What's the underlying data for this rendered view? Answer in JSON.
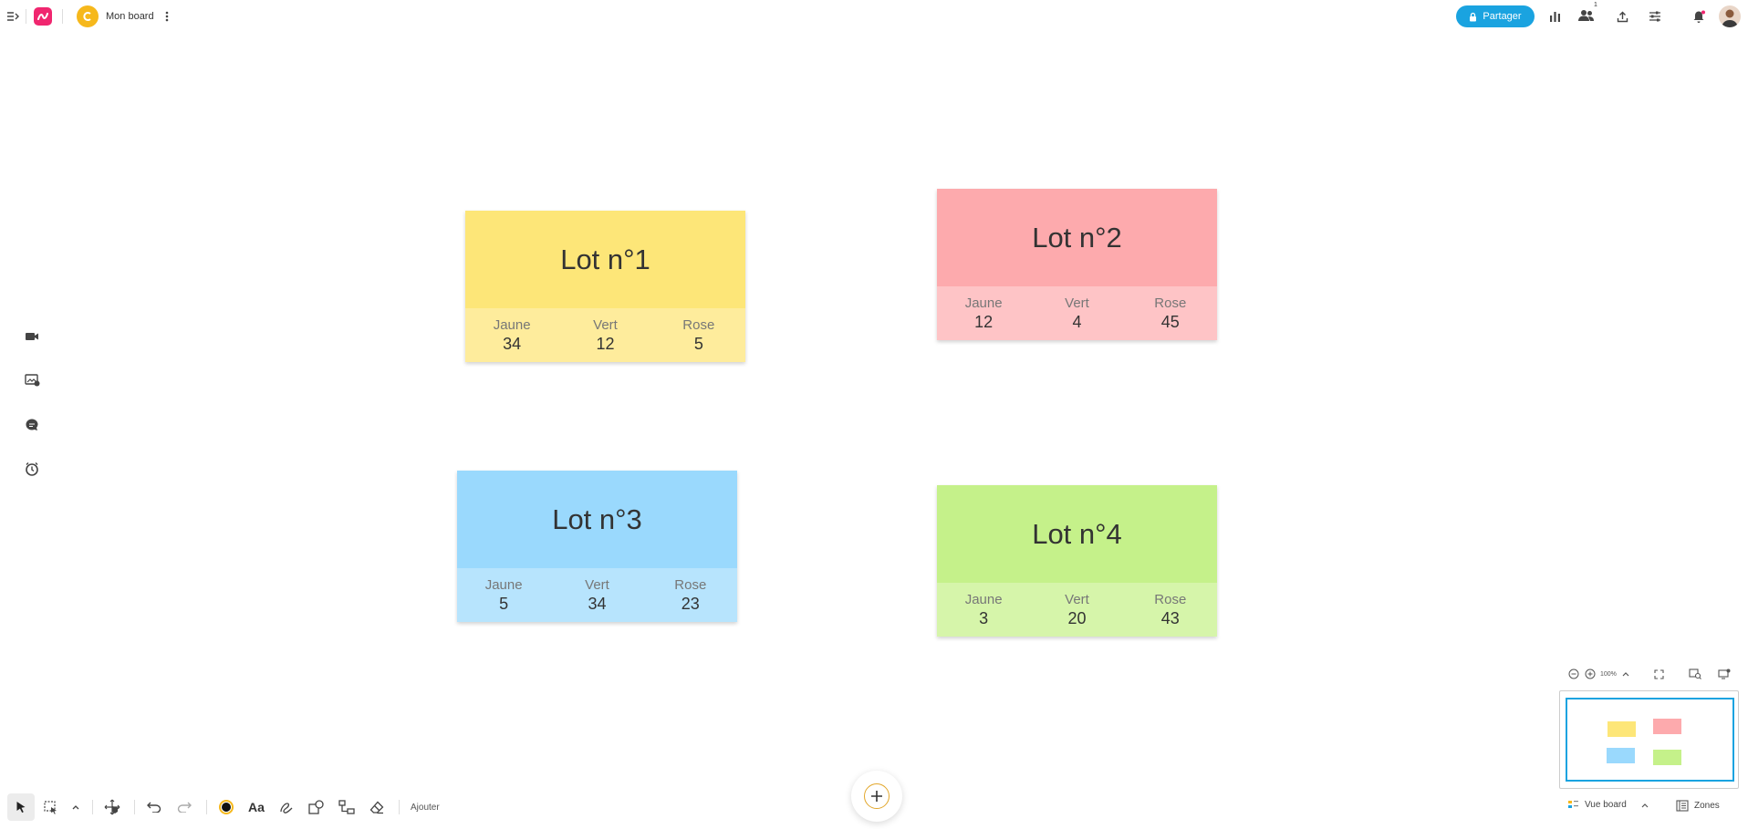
{
  "topbar": {
    "board_name": "Mon board",
    "share_label": "Partager",
    "collaborators_count": "1"
  },
  "cards": [
    {
      "title": "Lot n°1",
      "color_top": "#fde678",
      "color_bottom": "#feec9c",
      "stats": [
        {
          "label": "Jaune",
          "value": "34"
        },
        {
          "label": "Vert",
          "value": "12"
        },
        {
          "label": "Rose",
          "value": "5"
        }
      ]
    },
    {
      "title": "Lot n°2",
      "color_top": "#fdaaad",
      "color_bottom": "#fec4c6",
      "stats": [
        {
          "label": "Jaune",
          "value": "12"
        },
        {
          "label": "Vert",
          "value": "4"
        },
        {
          "label": "Rose",
          "value": "45"
        }
      ]
    },
    {
      "title": "Lot n°3",
      "color_top": "#9ad9fd",
      "color_bottom": "#b7e4fd",
      "stats": [
        {
          "label": "Jaune",
          "value": "5"
        },
        {
          "label": "Vert",
          "value": "34"
        },
        {
          "label": "Rose",
          "value": "23"
        }
      ]
    },
    {
      "title": "Lot n°4",
      "color_top": "#c5f18a",
      "color_bottom": "#d6f5aa",
      "stats": [
        {
          "label": "Jaune",
          "value": "3"
        },
        {
          "label": "Vert",
          "value": "20"
        },
        {
          "label": "Rose",
          "value": "43"
        }
      ]
    }
  ],
  "toolbar": {
    "add_label": "Ajouter"
  },
  "zoom": {
    "level": "100%"
  },
  "footer": {
    "view_board_label": "Vue board",
    "zones_label": "Zones"
  },
  "colors": {
    "accent": "#1aa3e0",
    "brand": "#f0266f",
    "board_logo": "#f6b81c"
  }
}
